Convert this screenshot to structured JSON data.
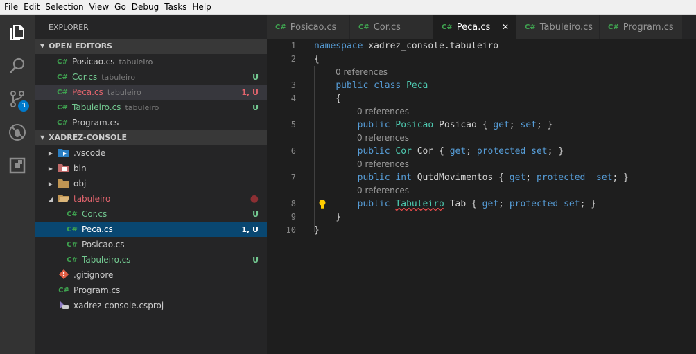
{
  "menu": [
    "File",
    "Edit",
    "Selection",
    "View",
    "Go",
    "Debug",
    "Tasks",
    "Help"
  ],
  "activity": {
    "scm_badge": "3"
  },
  "sidebar": {
    "title": "EXPLORER",
    "open_editors_label": "OPEN EDITORS",
    "project_label": "XADREZ-CONSOLE",
    "open_editors": [
      {
        "name": "Posicao.cs",
        "desc": "tabuleiro",
        "status": ""
      },
      {
        "name": "Cor.cs",
        "desc": "tabuleiro",
        "status": "U"
      },
      {
        "name": "Peca.cs",
        "desc": "tabuleiro",
        "status": "1, U"
      },
      {
        "name": "Tabuleiro.cs",
        "desc": "tabuleiro",
        "status": "U"
      },
      {
        "name": "Program.cs",
        "desc": "",
        "status": ""
      }
    ],
    "tree": {
      "vscode": ".vscode",
      "bin": "bin",
      "obj": "obj",
      "tabuleiro": "tabuleiro",
      "tabuleiro_files": [
        {
          "name": "Cor.cs",
          "status": "U"
        },
        {
          "name": "Peca.cs",
          "status": "1, U"
        },
        {
          "name": "Posicao.cs",
          "status": ""
        },
        {
          "name": "Tabuleiro.cs",
          "status": "U"
        }
      ],
      "gitignore": ".gitignore",
      "program": "Program.cs",
      "csproj": "xadrez-console.csproj"
    }
  },
  "tabs": [
    "Posicao.cs",
    "Cor.cs",
    "Peca.cs",
    "Tabuleiro.cs",
    "Program.cs"
  ],
  "tab_icon": "C#",
  "editor": {
    "lens_text": "0 references",
    "line_numbers": [
      "1",
      "2",
      "3",
      "4",
      "5",
      "6",
      "7",
      "8",
      "9",
      "10"
    ]
  },
  "colors": {
    "accent": "#007acc",
    "selection": "#094771",
    "git_untracked": "#73c991",
    "error": "#e2646d"
  }
}
